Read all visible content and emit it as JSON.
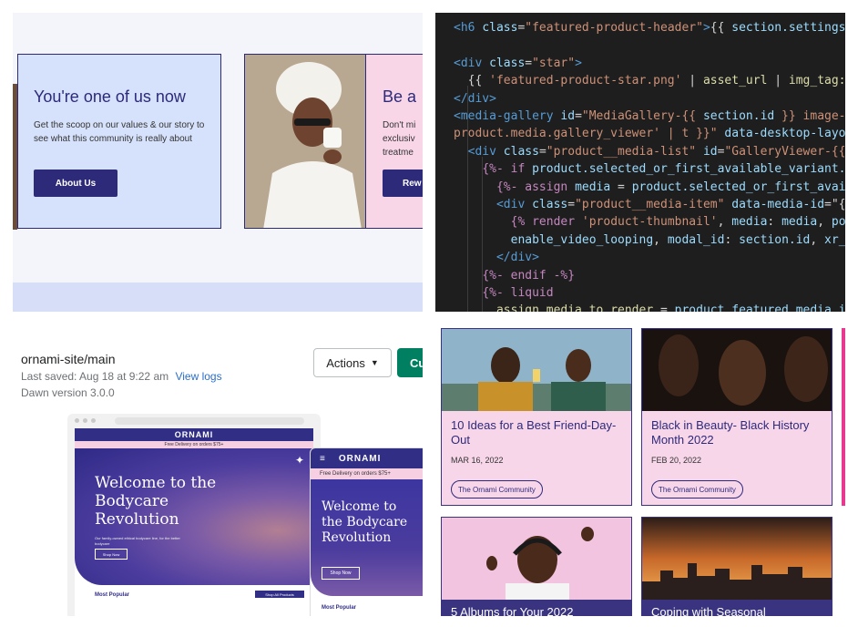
{
  "top_left": {
    "card1": {
      "title": "You're one of us now",
      "body": "Get the scoop on our values & our story to see what this community is really about",
      "button": "About Us"
    },
    "card2": {
      "title": "Be a",
      "body": "Don't mi\nexclusiv\ntreatme",
      "button": "Rew"
    }
  },
  "code": {
    "lines": [
      [
        [
          "tag",
          "<h6 "
        ],
        [
          "attr",
          "class"
        ],
        [
          "txt",
          "="
        ],
        [
          "str",
          "\"featured-product-header\""
        ],
        [
          "tag",
          ">"
        ],
        [
          "txt",
          "{{ "
        ],
        [
          "var",
          "section.settings"
        ]
      ],
      [],
      [
        [
          "tag",
          "<div "
        ],
        [
          "attr",
          "class"
        ],
        [
          "txt",
          "="
        ],
        [
          "str",
          "\"star\""
        ],
        [
          "tag",
          ">"
        ]
      ],
      [
        [
          "txt",
          "  {{ "
        ],
        [
          "str",
          "'featured-product-star.png'"
        ],
        [
          "txt",
          " | "
        ],
        [
          "fn",
          "asset_url"
        ],
        [
          "txt",
          " | "
        ],
        [
          "fn",
          "img_tag:"
        ]
      ],
      [
        [
          "tag",
          "</div>"
        ]
      ],
      [
        [
          "tag",
          "<media-gallery "
        ],
        [
          "attr",
          "id"
        ],
        [
          "txt",
          "="
        ],
        [
          "str",
          "\"MediaGallery-{{ "
        ],
        [
          "var",
          "section.id"
        ],
        [
          "str",
          " }} image-"
        ]
      ],
      [
        [
          "str",
          "product.media.gallery_viewer' | t }}\""
        ],
        [
          "txt",
          " "
        ],
        [
          "attr",
          "data-desktop-layo"
        ]
      ],
      [
        [
          "txt",
          "  "
        ],
        [
          "tag",
          "<div "
        ],
        [
          "attr",
          "class"
        ],
        [
          "txt",
          "="
        ],
        [
          "str",
          "\"product__media-list\""
        ],
        [
          "txt",
          " "
        ],
        [
          "attr",
          "id"
        ],
        [
          "txt",
          "="
        ],
        [
          "str",
          "\"GalleryViewer-{{"
        ]
      ],
      [
        [
          "txt",
          "    "
        ],
        [
          "kw",
          "{%- if "
        ],
        [
          "var",
          "product.selected_or_first_available_variant."
        ]
      ],
      [
        [
          "txt",
          "      "
        ],
        [
          "kw",
          "{%- assign "
        ],
        [
          "var",
          "media"
        ],
        [
          "txt",
          " = "
        ],
        [
          "var",
          "product.selected_or_first_avai"
        ]
      ],
      [
        [
          "txt",
          "      "
        ],
        [
          "tag",
          "<div "
        ],
        [
          "attr",
          "class"
        ],
        [
          "txt",
          "="
        ],
        [
          "str",
          "\"product__media-item\""
        ],
        [
          "txt",
          " "
        ],
        [
          "attr",
          "data-media-id"
        ],
        [
          "txt",
          "=\"{"
        ]
      ],
      [
        [
          "txt",
          "        "
        ],
        [
          "kw",
          "{% render "
        ],
        [
          "str",
          "'product-thumbnail'"
        ],
        [
          "txt",
          ", "
        ],
        [
          "var",
          "media"
        ],
        [
          "txt",
          ": "
        ],
        [
          "var",
          "media"
        ],
        [
          "txt",
          ", "
        ],
        [
          "var",
          "po"
        ]
      ],
      [
        [
          "txt",
          "        "
        ],
        [
          "var",
          "enable_video_looping"
        ],
        [
          "txt",
          ", "
        ],
        [
          "var",
          "modal_id"
        ],
        [
          "txt",
          ": "
        ],
        [
          "var",
          "section.id"
        ],
        [
          "txt",
          ", "
        ],
        [
          "var",
          "xr_"
        ]
      ],
      [
        [
          "txt",
          "      "
        ],
        [
          "tag",
          "</div>"
        ]
      ],
      [
        [
          "txt",
          "    "
        ],
        [
          "kw",
          "{%- endif -%}"
        ]
      ],
      [
        [
          "txt",
          "    "
        ],
        [
          "kw",
          "{%- liquid"
        ]
      ],
      [
        [
          "txt",
          "      "
        ],
        [
          "fn",
          "assign media to render"
        ],
        [
          "txt",
          " = "
        ],
        [
          "var",
          "product.featured_media.i"
        ]
      ]
    ]
  },
  "bottom_left": {
    "theme_name": "ornami-site/main",
    "last_saved": "Last saved: Aug 18 at 9:22 am",
    "view_logs": "View logs",
    "version": "Dawn version 3.0.0",
    "actions_label": "Actions",
    "customize_label": "Cu",
    "preview": {
      "brand": "ORNAMI",
      "delivery": "Free Delivery on orders $75+",
      "hero_title": "Welcome to the Bodycare Revolution",
      "hero_sub": "Our family-owned ethical bodycare line, for the better bodycare",
      "shop_now": "Shop Now",
      "most_popular": "Most Popular",
      "shop_all": "Shop All Products",
      "mobile_title": "Welcome to the Bodycare Revolution"
    }
  },
  "posts": [
    {
      "title": "10 Ideas for a Best Friend-Day-Out",
      "date": "MAR 16, 2022",
      "tag": "The Ornami Community"
    },
    {
      "title": "Black in Beauty- Black History Month 2022",
      "date": "FEB 20, 2022",
      "tag": "The Ornami Community"
    },
    {
      "title": "5 Albums for Your 2022",
      "date": "",
      "tag": ""
    },
    {
      "title": "Coping with Seasonal",
      "date": "",
      "tag": ""
    }
  ],
  "colors": {
    "brand_navy": "#2d2a7a",
    "card_blue": "#d6e2fb",
    "card_pink": "#f8d6ea",
    "green": "#008060"
  }
}
